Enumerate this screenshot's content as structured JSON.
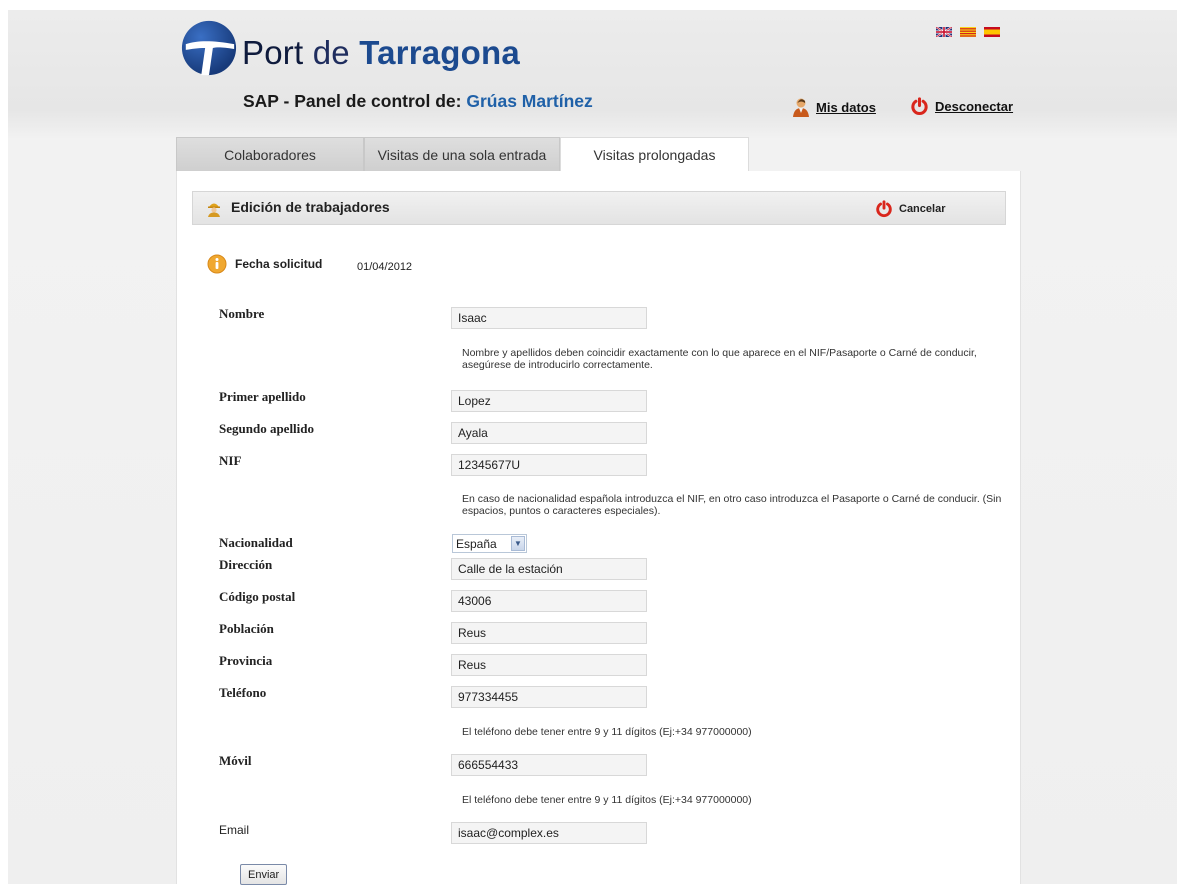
{
  "header": {
    "logo_word1": "Port",
    "logo_word2": "de",
    "logo_word3": "Tarragona",
    "subtitle_prefix": "SAP - Panel de control de:",
    "company": "Grúas Martínez",
    "languages": [
      "en-flag-icon",
      "ca-flag-icon",
      "es-flag-icon"
    ],
    "mis_datos": "Mis datos",
    "desconectar": "Desconectar"
  },
  "tabs": [
    {
      "label": "Colaboradores",
      "active": false
    },
    {
      "label": "Visitas de una sola entrada",
      "active": false
    },
    {
      "label": "Visitas prolongadas",
      "active": true
    }
  ],
  "editbar": {
    "title": "Edición de trabajadores",
    "cancel_label": "Cancelar"
  },
  "fecha": {
    "label": "Fecha solicitud",
    "value": "01/04/2012"
  },
  "form": {
    "nombre": {
      "label": "Nombre",
      "value": "Isaac"
    },
    "nombre_help": "Nombre y apellidos deben coincidir exactamente con lo que aparece en el NIF/Pasaporte o Carné de conducir, asegúrese de introducirlo correctamente.",
    "primer_apellido": {
      "label": "Primer apellido",
      "value": "Lopez"
    },
    "segundo_apellido": {
      "label": "Segundo apellido",
      "value": "Ayala"
    },
    "nif": {
      "label": "NIF",
      "value": "12345677U"
    },
    "nif_help": "En caso de nacionalidad española introduzca el NIF, en otro caso introduzca el Pasaporte o Carné de conducir. (Sin espacios, puntos o caracteres especiales).",
    "nacionalidad": {
      "label": "Nacionalidad",
      "value": "España"
    },
    "direccion": {
      "label": "Dirección",
      "value": "Calle de la estación"
    },
    "codigo_postal": {
      "label": "Código postal",
      "value": "43006"
    },
    "poblacion": {
      "label": "Población",
      "value": "Reus"
    },
    "provincia": {
      "label": "Provincia",
      "value": "Reus"
    },
    "telefono": {
      "label": "Teléfono",
      "value": "977334455"
    },
    "telefono_help": "El teléfono debe tener entre 9 y 11 dígitos (Ej:+34 977000000)",
    "movil": {
      "label": "Móvil",
      "value": "666554433"
    },
    "movil_help": "El teléfono debe tener entre 9 y 11 dígitos (Ej:+34 977000000)",
    "email": {
      "label": "Email",
      "value": "isaac@complex.es"
    },
    "submit_label": "Enviar"
  },
  "colors": {
    "brand_blue": "#1c4a8f",
    "company_blue": "#2061a8",
    "power_red": "#d9261c"
  }
}
